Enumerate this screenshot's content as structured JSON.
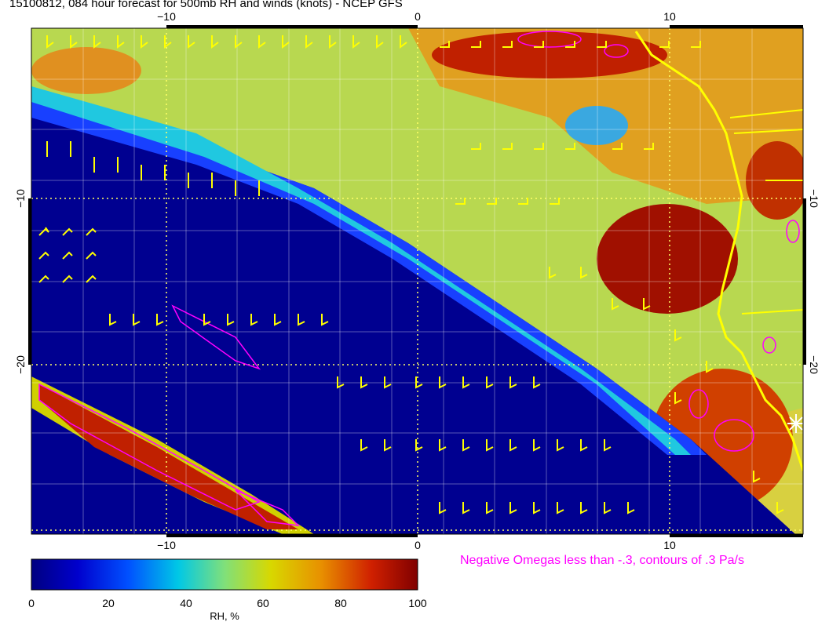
{
  "title": "15100812, 084 hour forecast for 500mb RH and winds (knots) - NCEP GFS",
  "map": {
    "x_ticks_top": [
      "−10",
      "0",
      "10"
    ],
    "x_ticks_bottom": [
      "−10",
      "0",
      "10"
    ],
    "y_ticks_left": [
      "−10",
      "−20"
    ],
    "y_ticks_right": [
      "−10",
      "−20"
    ],
    "x_range_deg": [
      -15,
      15
    ],
    "y_range_deg": [
      -30,
      0
    ],
    "gridlines": true,
    "contour_color": "#ff00ff",
    "coastline_color": "#ffff00",
    "barb_color": "#ffff00"
  },
  "note": "Negative Omegas less than -.3, contours of .3 Pa/s",
  "colorbar": {
    "label": "RH, %",
    "ticks": [
      "0",
      "20",
      "40",
      "60",
      "80",
      "100"
    ],
    "range": [
      0,
      100
    ],
    "colors": [
      "#000080",
      "#0000cd",
      "#0050ff",
      "#00c8e6",
      "#80e07a",
      "#d8d800",
      "#e89000",
      "#d02000",
      "#800000"
    ]
  }
}
